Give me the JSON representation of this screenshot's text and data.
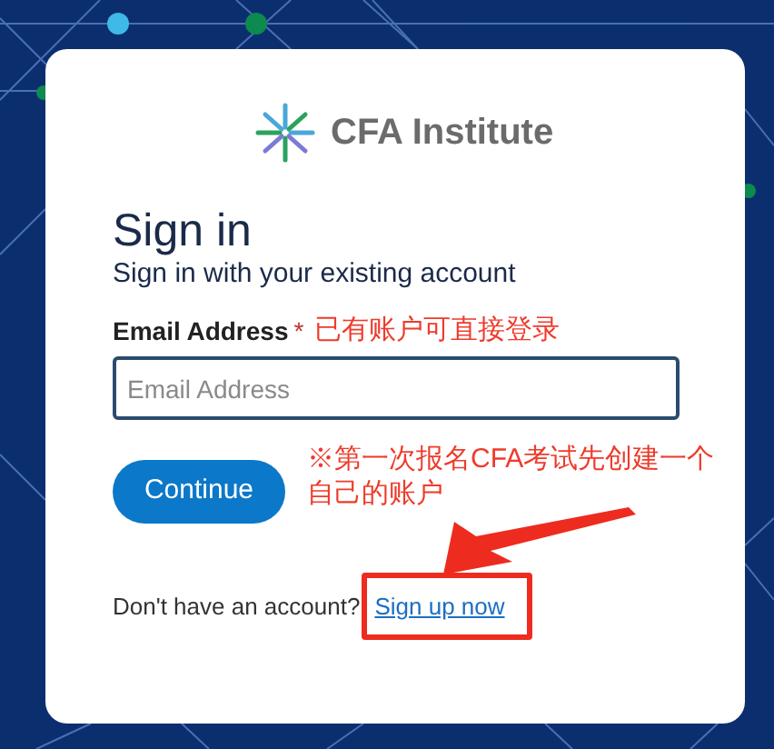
{
  "logo": {
    "text": "CFA Institute"
  },
  "heading": "Sign in",
  "subtitle": "Sign in with your existing account",
  "email": {
    "label": "Email Address",
    "required_mark": "*",
    "placeholder": "Email Address"
  },
  "continue_button": "Continue",
  "signup": {
    "prompt": "Don't have an account?",
    "link": "Sign up now"
  },
  "annotations": {
    "email_note": "已有账户可直接登录",
    "signup_note": "※第一次报名CFA考试先创建一个自己的账户"
  }
}
